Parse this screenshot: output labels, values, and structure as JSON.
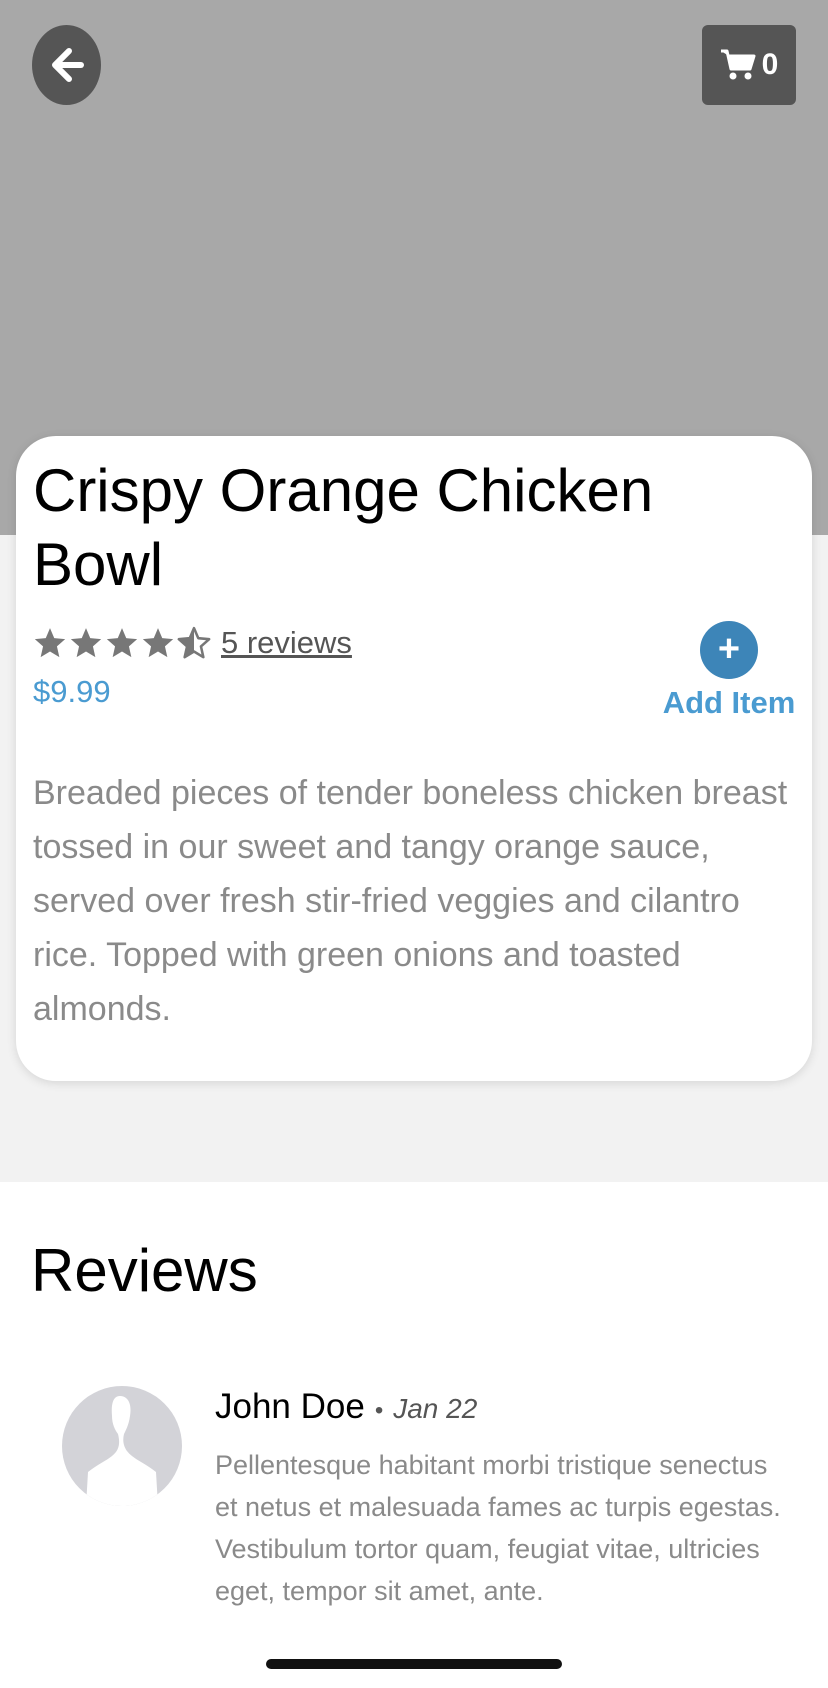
{
  "header": {
    "back_icon": "arrow-left-icon",
    "cart_icon": "shopping-cart-icon",
    "cart_count": "0"
  },
  "item": {
    "title": "Crispy Orange Chicken Bowl",
    "rating": 4.5,
    "rating_max": 5,
    "reviews_link": "5 reviews",
    "price": "$9.99",
    "add_icon": "+",
    "add_label": "Add Item",
    "description": "Breaded pieces of tender boneless chicken breast tossed in our sweet and tangy orange sauce, served over fresh stir-fried veggies and cilantro rice. Topped with green onions and toasted almonds."
  },
  "reviews": {
    "heading": "Reviews",
    "items": [
      {
        "name": "John Doe",
        "separator": "•",
        "date": "Jan 22",
        "text": "Pellentesque habitant morbi tristique senectus et netus et malesuada fames ac turpis egestas. Vestibulum tortor quam, feugiat vitae, ultricies eget, tempor sit amet, ante."
      }
    ]
  },
  "colors": {
    "hero_bg": "#a8a8a8",
    "accent": "#4a9bd1",
    "add_button": "#3d85b8",
    "star": "#777777"
  }
}
